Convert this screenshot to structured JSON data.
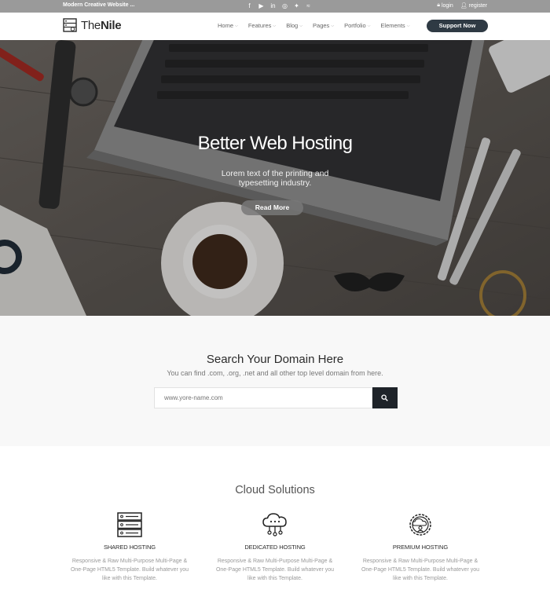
{
  "topbar": {
    "tagline": "Modern Creative Website ...",
    "socials": [
      "facebook-icon",
      "youtube-icon",
      "linkedin-icon",
      "dribbble-icon",
      "twitter-icon",
      "rss-icon"
    ],
    "login": "login",
    "register": "register"
  },
  "header": {
    "logo_prefix": "The",
    "logo_bold": "Nile",
    "nav": [
      {
        "label": "Home"
      },
      {
        "label": "Features"
      },
      {
        "label": "Blog"
      },
      {
        "label": "Pages"
      },
      {
        "label": "Portfolio"
      },
      {
        "label": "Elements"
      }
    ],
    "support_button": "Support Now"
  },
  "hero": {
    "title": "Better Web Hosting",
    "subtitle": "Lorem text of the printing and typesetting industry.",
    "button": "Read More"
  },
  "domain": {
    "title": "Search Your Domain Here",
    "subtitle": "You can find .com, .org, .net and all other top level domain from here.",
    "placeholder": "www.yore-name.com"
  },
  "cloud": {
    "title": "Cloud Solutions",
    "services": [
      {
        "label": "SHARED HOSTING",
        "desc": "Responsive & Raw Multi-Purpose Multi-Page & One-Page HTML5 Template. Build whatever you like with this Template."
      },
      {
        "label": "DEDICATED HOSTING",
        "desc": "Responsive & Raw Multi-Purpose Multi-Page & One-Page HTML5 Template. Build whatever you like with this Template."
      },
      {
        "label": "PREMIUM HOSTING",
        "desc": "Responsive & Raw Multi-Purpose Multi-Page & One-Page HTML5 Template. Build whatever you like with this Template."
      }
    ]
  },
  "colors": {
    "topbar": "#9a9a9a",
    "accent_button": "#2f3a44",
    "search_button": "#1e2329",
    "section_bg": "#f8f8f8"
  }
}
